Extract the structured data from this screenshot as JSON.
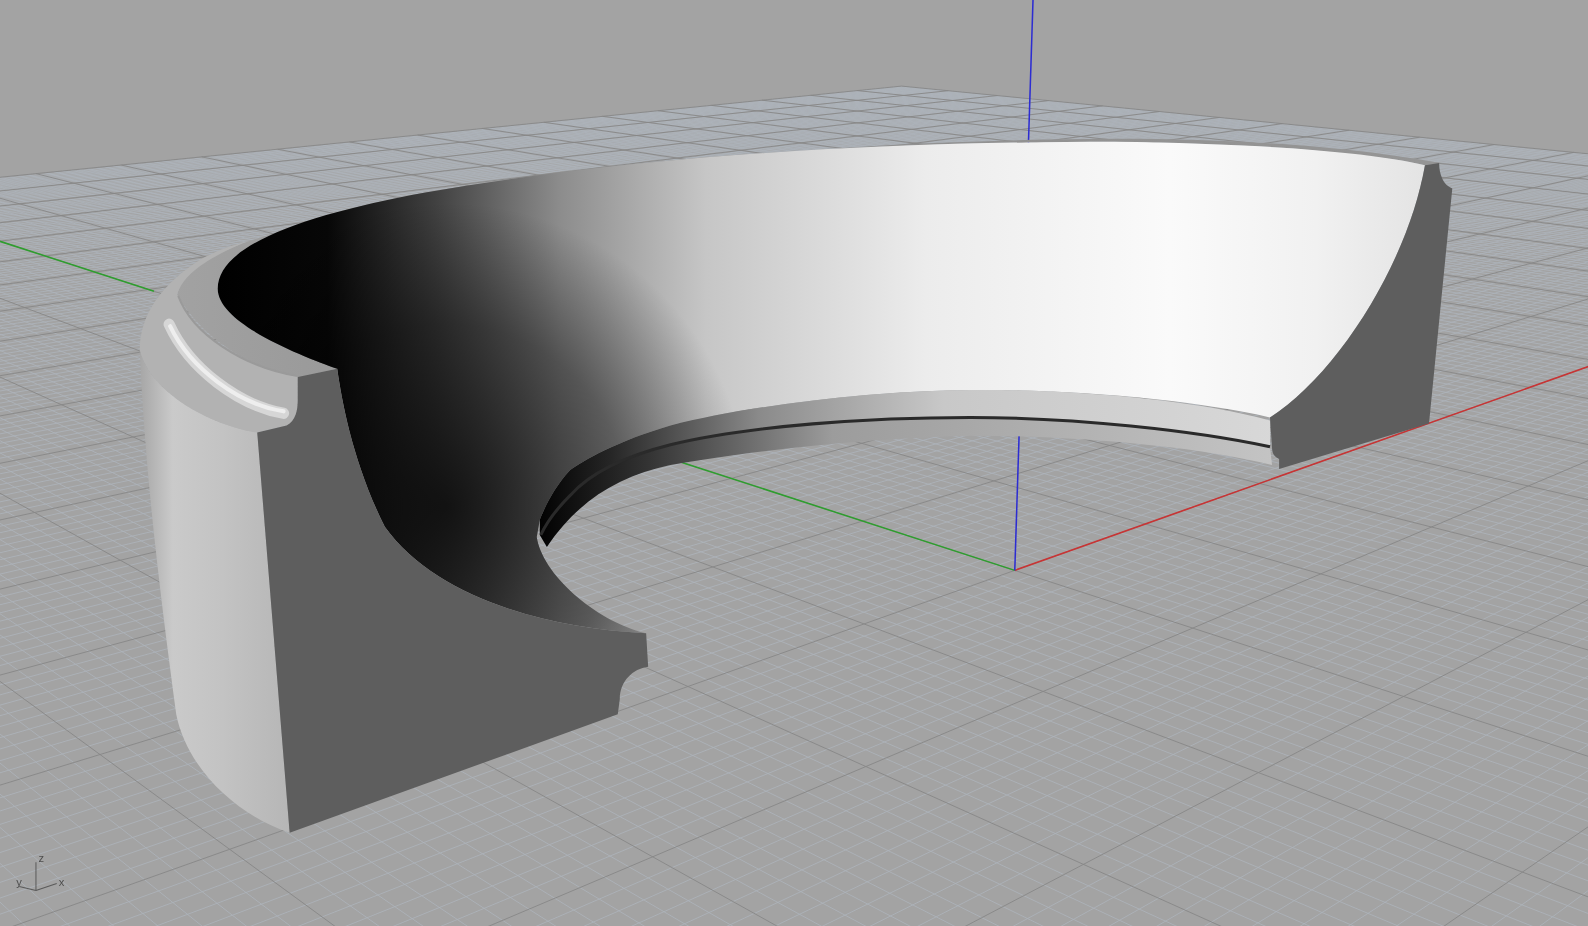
{
  "viewport": {
    "axis_indicator": {
      "z_label": "z",
      "y_label": "y",
      "x_label": "x"
    }
  }
}
